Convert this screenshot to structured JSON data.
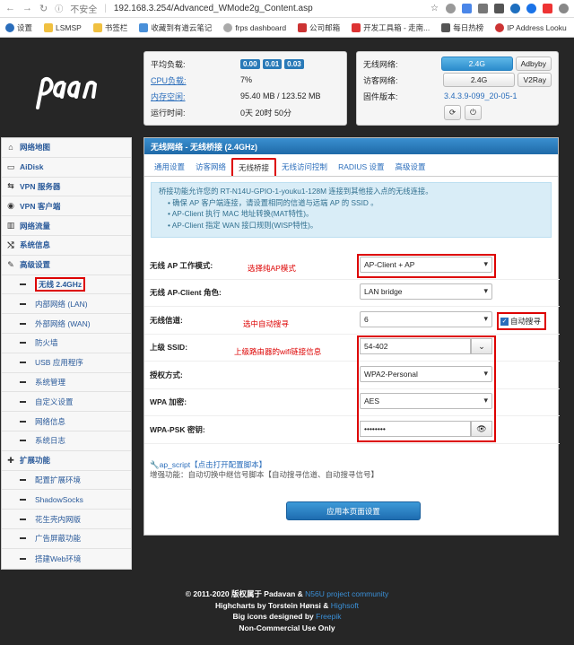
{
  "browser": {
    "insecure": "不安全",
    "url": "192.168.3.254/Advanced_WMode2g_Content.asp",
    "bookmarks": [
      "设置",
      "LSMSP",
      "书签栏",
      "收藏到有道云笔记",
      "frps dashboard",
      "公司邮箱",
      "开发工具箱 - 走南...",
      "每日热榜",
      "IP Address Looku"
    ]
  },
  "status": {
    "load_label": "平均负载:",
    "load_values": [
      "0.00",
      "0.01",
      "0.03"
    ],
    "cpu_label": "CPU负载:",
    "cpu_value": "7%",
    "mem_label": "内存空闲:",
    "mem_value": "95.40 MB / 123.52 MB",
    "uptime_label": "运行时间:",
    "uptime_value": "0天 20时 50分",
    "wifi_label": "无线网络:",
    "wifi_value": "2.4G",
    "wifi_btn": "Adbyby",
    "guest_label": "访客网络:",
    "guest_value": "2.4G",
    "guest_btn": "V2Ray",
    "fw_label": "固件版本:",
    "fw_value": "3.4.3.9-099_20-05-1"
  },
  "sidebar": {
    "items": [
      {
        "label": "网络地图",
        "icon": "home-icon"
      },
      {
        "label": "AiDisk",
        "icon": "drive-icon"
      },
      {
        "label": "VPN 服务器",
        "icon": "vpn-icon"
      },
      {
        "label": "VPN 客户端",
        "icon": "globe-icon"
      },
      {
        "label": "网络流量",
        "icon": "chart-icon"
      },
      {
        "label": "系统信息",
        "icon": "shuffle-icon"
      },
      {
        "label": "高级设置",
        "icon": "wrench-icon"
      }
    ],
    "sub1": [
      "无线 2.4GHz",
      "内部网络 (LAN)",
      "外部网络 (WAN)",
      "防火墙",
      "USB 应用程序",
      "系统管理",
      "自定义设置",
      "网络信息",
      "系统日志"
    ],
    "ext_label": "扩展功能",
    "sub2": [
      "配置扩展环境",
      "ShadowSocks",
      "花生壳内网版",
      "广告屏蔽功能",
      "搭建Web环境"
    ]
  },
  "panel": {
    "title": "无线网络 - 无线桥接 (2.4GHz)",
    "tabs": [
      "通用设置",
      "访客网络",
      "无线桥接",
      "无线访问控制",
      "RADIUS 设置",
      "高级设置"
    ],
    "info_intro": "桥接功能允许您的 RT-N14U-GPIO-1-youku1-128M 连接到其他接入点的无线连接。",
    "info_items": [
      "确保 AP 客户端连接，请设置相同的信道与远端 AP 的 SSID 。",
      "AP-Client 执行 MAC 地址转换(MAT特性)。",
      "AP-Client 指定 WAN 接口规则(WISP特性)。"
    ],
    "fields": {
      "mode_label": "无线 AP 工作模式:",
      "mode_value": "AP-Client + AP",
      "role_label": "无线 AP-Client 角色:",
      "role_value": "LAN bridge",
      "channel_label": "无线信道:",
      "channel_value": "6",
      "auto_label": "自动搜寻",
      "ssid_label": "上级 SSID:",
      "ssid_value": "54-402",
      "auth_label": "授权方式:",
      "auth_value": "WPA2-Personal",
      "enc_label": "WPA 加密:",
      "enc_value": "AES",
      "psk_label": "WPA-PSK 密钥:",
      "psk_value": "••••••••"
    },
    "notes": {
      "mode": "选择纯AP模式",
      "channel": "选中自动搜寻",
      "ssid": "上级路由器的wifi链接信息"
    },
    "script_title": "ap_script【点击打开配置脚本】",
    "script_desc": "增强功能：自动切换中继信号脚本【自动搜寻信道、自动搜寻信号】",
    "apply": "应用本页面设置"
  },
  "footer": {
    "line1": "© 2011-2020 版权属于 Padavan &",
    "line1_link": "N56U project community",
    "line2": "Highcharts by Torstein Hønsi &",
    "line2_link": "Highsoft",
    "line3": "Big icons designed by",
    "line3_link": "Freepik",
    "line4": "Non-Commercial Use Only"
  }
}
